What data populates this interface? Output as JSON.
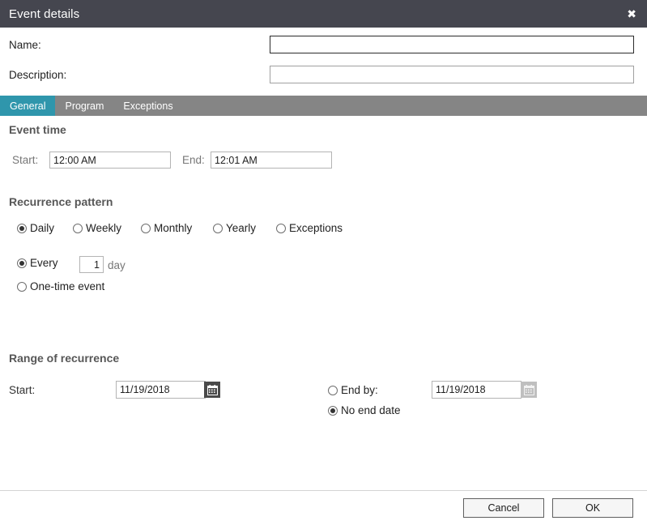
{
  "titlebar": {
    "title": "Event details",
    "close_icon": "close-icon",
    "close_glyph": "✖",
    "background": "#45464F"
  },
  "header": {
    "name": {
      "label": "Name:",
      "value": "",
      "placeholder": ""
    },
    "description": {
      "label": "Description:",
      "value": "",
      "placeholder": ""
    }
  },
  "tabs": {
    "active_color": "#2F96AC",
    "bar_color": "#858585",
    "items": [
      {
        "label": "General",
        "active": true
      },
      {
        "label": "Program",
        "active": false
      },
      {
        "label": "Exceptions",
        "active": false
      }
    ]
  },
  "event_time": {
    "heading": "Event time",
    "start_label": "Start:",
    "start_value": "12:00 AM",
    "end_label": "End:",
    "end_value": "12:01 AM"
  },
  "recurrence_pattern": {
    "heading": "Recurrence pattern",
    "frequency_options": [
      {
        "label": "Daily",
        "selected": true
      },
      {
        "label": "Weekly",
        "selected": false
      },
      {
        "label": "Monthly",
        "selected": false
      },
      {
        "label": "Yearly",
        "selected": false
      },
      {
        "label": "Exceptions",
        "selected": false
      }
    ],
    "every_option": {
      "label": "Every",
      "selected": true
    },
    "every_value": "1",
    "every_unit": "day",
    "one_time_option": {
      "label": "One-time event",
      "selected": false
    }
  },
  "range_of_recurrence": {
    "heading": "Range of recurrence",
    "start_label": "Start:",
    "start_value": "11/19/2018",
    "start_calendar_icon": "calendar-icon",
    "end_by": {
      "label": "End by:",
      "selected": false
    },
    "end_by_value": "11/19/2018",
    "end_by_calendar_icon": "calendar-icon",
    "no_end_date": {
      "label": "No end date",
      "selected": true
    }
  },
  "footer": {
    "cancel_label": "Cancel",
    "ok_label": "OK"
  }
}
